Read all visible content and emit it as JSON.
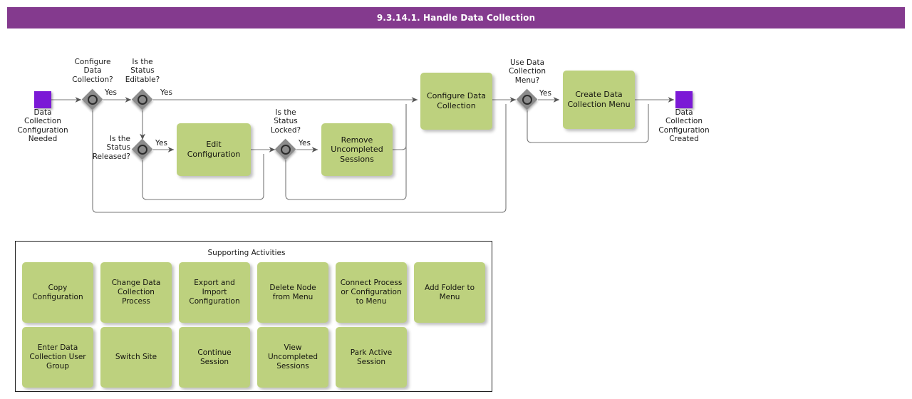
{
  "header": {
    "title": "9.3.14.1. Handle Data Collection"
  },
  "diagram": {
    "start_event": {
      "label": "Data\nCollection\nConfiguration\nNeeded",
      "color": "#7b19d6"
    },
    "end_event": {
      "label": "Data\nCollection\nConfiguration\nCreated",
      "color": "#7b19d6"
    },
    "gateways": [
      {
        "id": "g1",
        "label": "Configure\nData\nCollection?",
        "yes_label": "Yes"
      },
      {
        "id": "g2",
        "label": "Is the\nStatus\nEditable?",
        "yes_label": "Yes"
      },
      {
        "id": "g3",
        "label": "Is the\nStatus\nReleased?",
        "yes_label": "Yes"
      },
      {
        "id": "g4",
        "label": "Is the\nStatus\nLocked?",
        "yes_label": "Yes"
      },
      {
        "id": "g5",
        "label": "Use Data\nCollection\nMenu?",
        "yes_label": "Yes"
      }
    ],
    "tasks": [
      {
        "id": "t1",
        "label": "Edit\nConfiguration"
      },
      {
        "id": "t2",
        "label": "Remove\nUncompleted\nSessions"
      },
      {
        "id": "t3",
        "label": "Configure Data\nCollection"
      },
      {
        "id": "t4",
        "label": "Create Data\nCollection Menu"
      }
    ],
    "task_color": "#bdd17e",
    "gateway_color": "#8c8c8c"
  },
  "supporting": {
    "title": "Supporting Activities",
    "items": [
      {
        "label": "Copy\nConfiguration"
      },
      {
        "label": "Change Data\nCollection\nProcess"
      },
      {
        "label": "Export and\nImport\nConfiguration"
      },
      {
        "label": "Delete Node\nfrom Menu"
      },
      {
        "label": "Connect Process\nor Configuration\nto Menu"
      },
      {
        "label": "Add Folder to\nMenu"
      },
      {
        "label": "Enter Data\nCollection User\nGroup"
      },
      {
        "label": "Switch Site"
      },
      {
        "label": "Continue\nSession"
      },
      {
        "label": "View\nUncompleted\nSessions"
      },
      {
        "label": "Park Active\nSession"
      }
    ]
  }
}
